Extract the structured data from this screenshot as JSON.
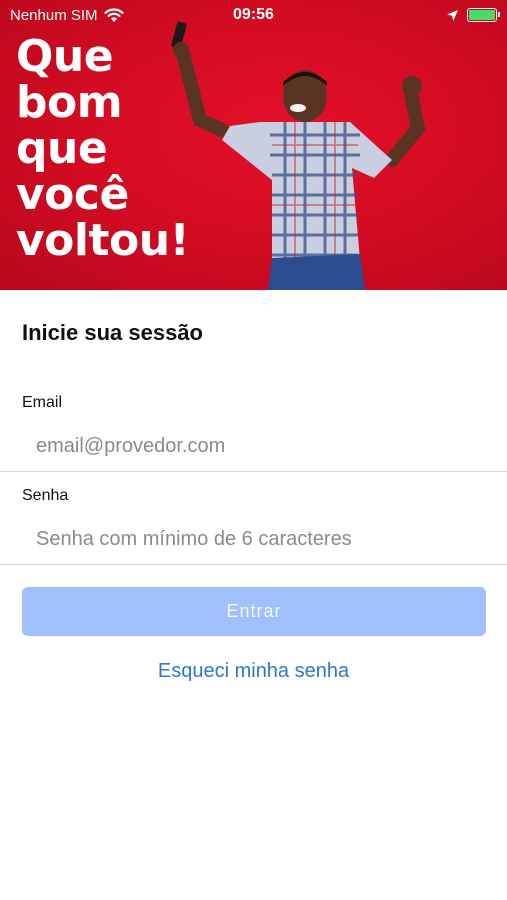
{
  "status_bar": {
    "carrier": "Nenhum SIM",
    "time": "09:56",
    "battery_color": "#4cd964"
  },
  "hero": {
    "title_lines": [
      "Que",
      "bom",
      "que",
      "você",
      "voltou!"
    ],
    "background_color": "#d50c23"
  },
  "login": {
    "title": "Inicie sua sessão",
    "email_label": "Email",
    "email_placeholder": "email@provedor.com",
    "email_value": "",
    "password_label": "Senha",
    "password_placeholder": "Senha com mínimo de 6 caracteres",
    "password_value": "",
    "submit_label": "Entrar",
    "submit_color": "#9fc0fb",
    "forgot_label": "Esqueci minha senha",
    "link_color": "#2f78c9"
  }
}
